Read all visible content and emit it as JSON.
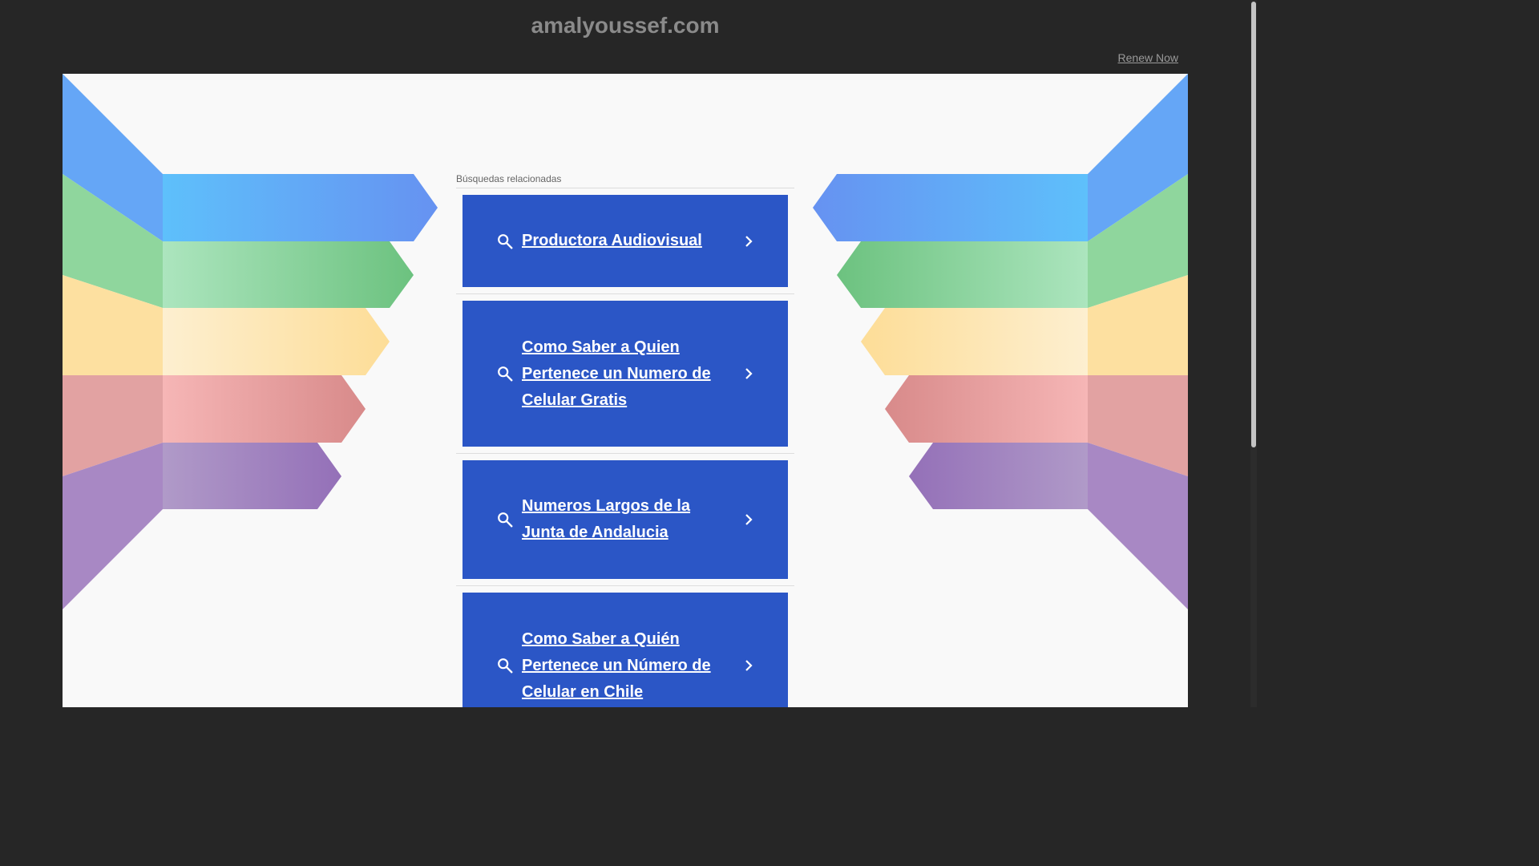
{
  "header": {
    "domain": "amalyoussef.com",
    "renew_label": "Renew Now"
  },
  "related": {
    "label": "Búsquedas relacionadas",
    "items": [
      {
        "label": "Productora Audiovisual"
      },
      {
        "label": "Como Saber a Quien Pertenece un Numero de Celular Gratis"
      },
      {
        "label": "Numeros Largos de la Junta de Andalucia"
      },
      {
        "label": "Como Saber a Quién Pertenece un Número de Celular en Chile"
      }
    ]
  },
  "icons": {
    "search": "search-icon",
    "chevron": "chevron-right-icon"
  },
  "colors": {
    "background": "#262626",
    "content_bg": "#f9f9f9",
    "card_bg": "#2b56c6",
    "stripe_blue": "#5b9cf8",
    "stripe_green": "#7fcf8d",
    "stripe_yellow": "#fde3a2",
    "stripe_red": "#e4999a",
    "stripe_purple": "#a58dc4"
  }
}
